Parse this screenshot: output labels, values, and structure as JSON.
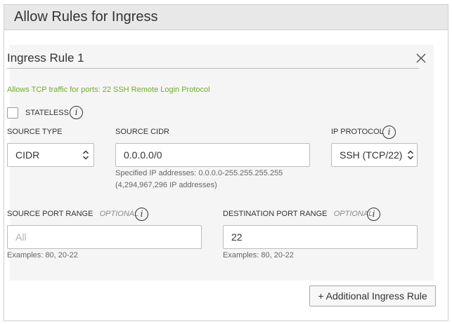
{
  "panel": {
    "title": "Allow Rules for Ingress"
  },
  "rule": {
    "title": "Ingress Rule 1",
    "description": "Allows TCP traffic for ports: 22 SSH Remote Login Protocol",
    "stateless": {
      "label": "STATELESS",
      "checked": false
    },
    "source_type": {
      "label": "SOURCE TYPE",
      "value": "CIDR"
    },
    "source_cidr": {
      "label": "SOURCE CIDR",
      "value": "0.0.0.0/0",
      "help_line1": "Specified IP addresses: 0.0.0.0-255.255.255.255",
      "help_line2": "(4,294,967,296 IP addresses)"
    },
    "ip_protocol": {
      "label": "IP PROTOCOL",
      "value": "SSH (TCP/22)"
    },
    "source_port_range": {
      "label": "SOURCE PORT RANGE",
      "optional": "OPTIONAL",
      "placeholder": "All",
      "value": "",
      "help": "Examples: 80, 20-22"
    },
    "destination_port_range": {
      "label": "DESTINATION PORT RANGE",
      "optional": "OPTIONAL",
      "value": "22",
      "help": "Examples: 80, 20-22"
    }
  },
  "actions": {
    "add_rule_label": "+ Additional Ingress Rule"
  },
  "icons": {
    "info": "info-icon",
    "close": "close-icon",
    "chevrons": "chevron-up-down-icon"
  },
  "colors": {
    "description": "#6fae2b",
    "header_bg": "#e8e8e8",
    "card_bg": "#f5f5f5"
  }
}
